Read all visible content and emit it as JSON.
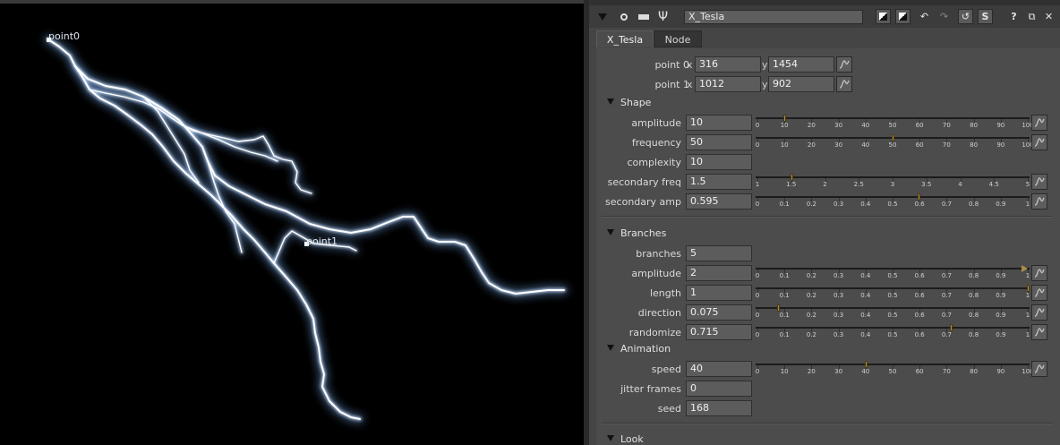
{
  "viewer": {
    "point0_label": "point0",
    "point1_label": "point1",
    "background": "#000000",
    "bolt_color": "#ffffff",
    "glow_color": "#7fb8ff"
  },
  "node": {
    "name": "X_Tesla",
    "tabs": [
      "X_Tesla",
      "Node"
    ]
  },
  "toolbar": {
    "help": "?",
    "float": "⧉",
    "close": "✕",
    "s_button": "S"
  },
  "points": {
    "point0": {
      "label": "point 0",
      "x": "316",
      "y": "1454"
    },
    "point1": {
      "label": "point 1",
      "x": "1012",
      "y": "902"
    },
    "x_axis": "x",
    "y_axis": "y"
  },
  "sections": {
    "shape": "Shape",
    "branches": "Branches",
    "animation": "Animation",
    "look": "Look"
  },
  "params": {
    "amplitude": {
      "label": "amplitude",
      "value": "10"
    },
    "frequency": {
      "label": "frequency",
      "value": "50"
    },
    "complexity": {
      "label": "complexity",
      "value": "10"
    },
    "secondary_freq": {
      "label": "secondary freq",
      "value": "1.5"
    },
    "secondary_amp": {
      "label": "secondary amp",
      "value": "0.595"
    },
    "branches": {
      "label": "branches",
      "value": "5"
    },
    "b_amplitude": {
      "label": "amplitude",
      "value": "2"
    },
    "length": {
      "label": "length",
      "value": "1"
    },
    "direction": {
      "label": "direction",
      "value": "0.075"
    },
    "randomize": {
      "label": "randomize",
      "value": "0.715"
    },
    "speed": {
      "label": "speed",
      "value": "40"
    },
    "jitter_frames": {
      "label": "jitter frames",
      "value": "0"
    },
    "seed": {
      "label": "seed",
      "value": "168"
    }
  },
  "sliders": {
    "scale_0_100": {
      "ticks": [
        "0",
        "10",
        "20",
        "30",
        "40",
        "50",
        "60",
        "70",
        "80",
        "90",
        "100"
      ],
      "min": 0,
      "max": 100
    },
    "scale_0_1": {
      "ticks": [
        "0",
        "0.1",
        "0.2",
        "0.3",
        "0.4",
        "0.5",
        "0.6",
        "0.7",
        "0.8",
        "0.9",
        "1"
      ],
      "min": 0,
      "max": 1
    },
    "scale_1_5": {
      "ticks": [
        "1",
        "1.5",
        "2",
        "2.5",
        "3",
        "3.5",
        "4",
        "4.5",
        "5"
      ],
      "min": 1,
      "max": 5
    }
  },
  "colors": {
    "panel_bg": "#4c4c4c",
    "field_bg": "#5c5c5c",
    "slider_handle": "#a98e45"
  }
}
